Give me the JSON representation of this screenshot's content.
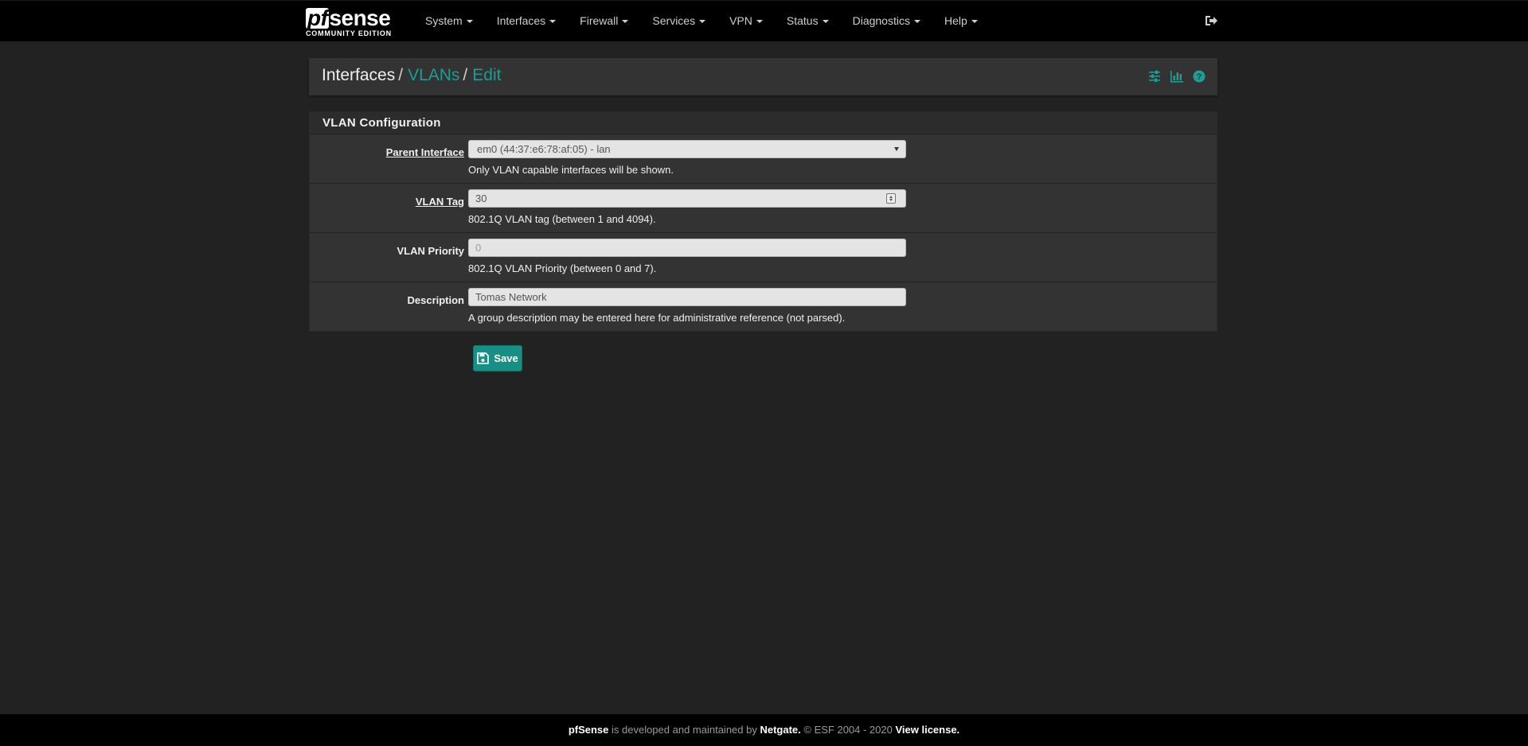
{
  "navbar": {
    "logo_main_pf": "pf",
    "logo_main_sense": "sense",
    "logo_sub": "COMMUNITY EDITION",
    "menu": [
      {
        "label": "System"
      },
      {
        "label": "Interfaces"
      },
      {
        "label": "Firewall"
      },
      {
        "label": "Services"
      },
      {
        "label": "VPN"
      },
      {
        "label": "Status"
      },
      {
        "label": "Diagnostics"
      },
      {
        "label": "Help"
      }
    ],
    "logout_icon": "sign-out-icon"
  },
  "breadcrumb": {
    "root": "Interfaces",
    "sep1": "/",
    "link": "VLANs",
    "sep2": "/",
    "active": "Edit",
    "tools": [
      "sliders-icon",
      "bar-chart-icon",
      "question-circle-icon"
    ]
  },
  "panel": {
    "title": "VLAN Configuration",
    "rows": {
      "parent_interface": {
        "label": "Parent Interface",
        "value": "em0 (44:37:e6:78:af:05) - lan",
        "help": "Only VLAN capable interfaces will be shown."
      },
      "vlan_tag": {
        "label": "VLAN Tag",
        "value": "30",
        "help": "802.1Q VLAN tag (between 1 and 4094)."
      },
      "vlan_priority": {
        "label": "VLAN Priority",
        "placeholder": "0",
        "help": "802.1Q VLAN Priority (between 0 and 7)."
      },
      "description": {
        "label": "Description",
        "value": "Tomas Network",
        "help": "A group description may be entered here for administrative reference (not parsed)."
      }
    }
  },
  "save_button": {
    "label": "Save",
    "icon": "save-icon"
  },
  "footer": {
    "brand": "pfSense",
    "text1": " is developed and maintained by ",
    "company": "Netgate.",
    "text2": " © ESF 2004 - 2020 ",
    "license_link": "View license."
  },
  "colors": {
    "accent": "#1e9d92",
    "background": "#222222",
    "panel": "#333333",
    "navbar": "#000000"
  }
}
